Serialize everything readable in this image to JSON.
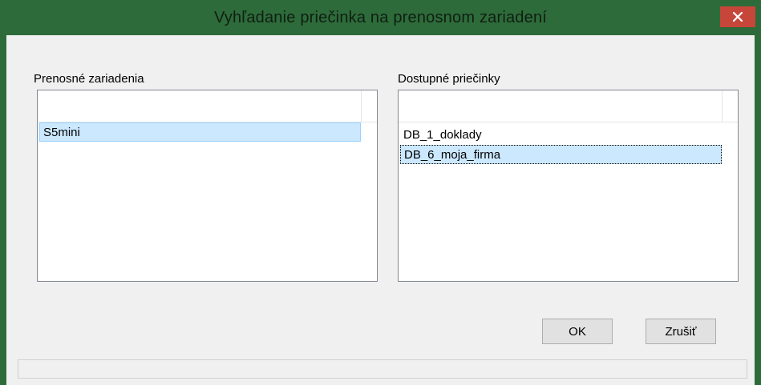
{
  "window": {
    "title": "Vyhľadanie priečinka na prenosnom zariadení",
    "close_icon": "close-icon"
  },
  "devices": {
    "label": "Prenosné zariadenia",
    "items": [
      "S5mini"
    ],
    "selected": "S5mini"
  },
  "folders": {
    "label": "Dostupné priečinky",
    "items": [
      "DB_1_doklady",
      "DB_6_moja_firma"
    ],
    "selected": "DB_6_moja_firma"
  },
  "buttons": {
    "ok": "OK",
    "cancel": "Zrušiť"
  },
  "colors": {
    "titlebar": "#2e6b3a",
    "close": "#c7463a",
    "selection": "#cce8ff"
  }
}
